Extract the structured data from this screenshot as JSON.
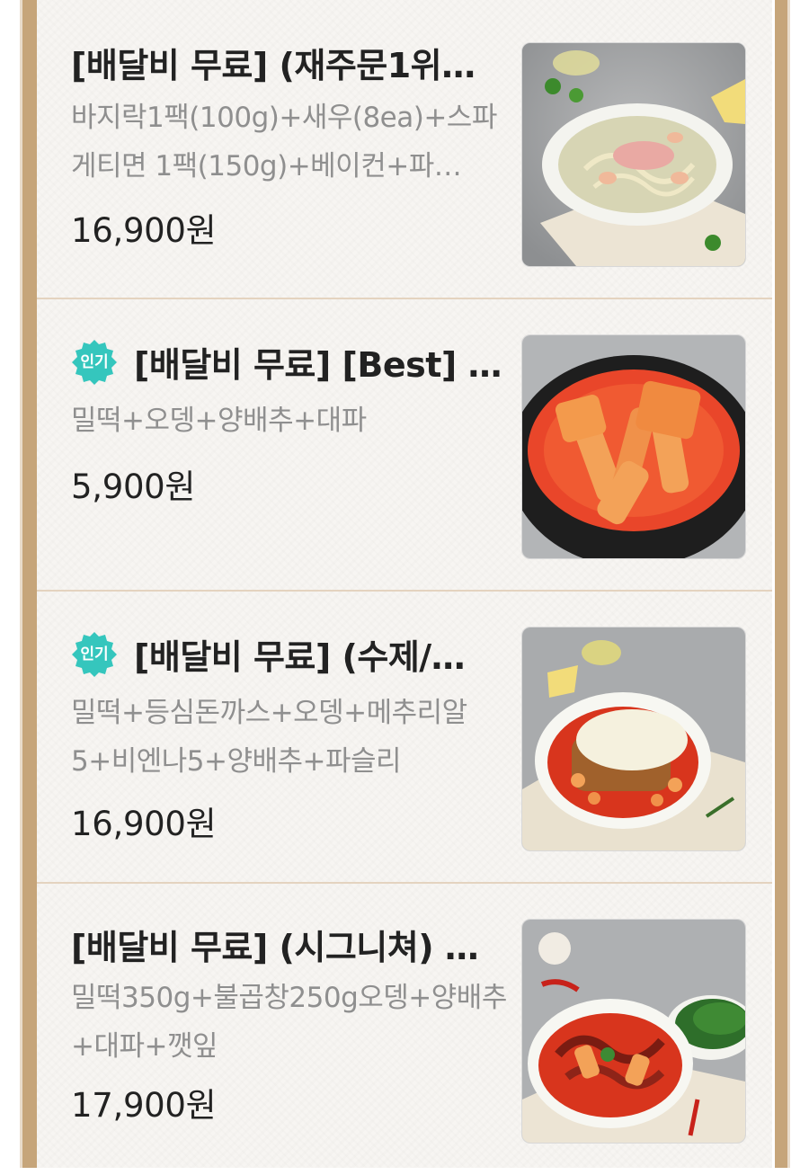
{
  "menu": {
    "items": [
      {
        "badge": "",
        "title": "[배달비 무료] (재주문1위…",
        "description": "바지락1팩(100g)+새우(8ea)+스파게티면 1팩(150g)+베이컨+파…",
        "price": "16,900원",
        "image_icon": "cream-pasta-image"
      },
      {
        "badge": "인기",
        "title": "[배달비 무료] [Best] …",
        "description": "밀떡+오뎅+양배추+대파",
        "price": "5,900원",
        "image_icon": "tteokbokki-image"
      },
      {
        "badge": "인기",
        "title": "[배달비 무료] (수제/…",
        "description": "밀떡+등심돈까스+오뎅+메추리알5+비엔나5+양배추+파슬리",
        "price": "16,900원",
        "image_icon": "cheese-cutlet-tteokbokki-image"
      },
      {
        "badge": "",
        "title": "[배달비 무료] (시그니쳐) …",
        "description": "밀떡350g+불곱창250g오뎅+양배추+대파+깻잎",
        "price": "17,900원",
        "image_icon": "gopchang-tteokbokki-image"
      }
    ]
  },
  "colors": {
    "frame": "#c6a57a",
    "background": "#f7f5f2",
    "badge": "#35c6bd",
    "divider": "#e4d3bf"
  }
}
